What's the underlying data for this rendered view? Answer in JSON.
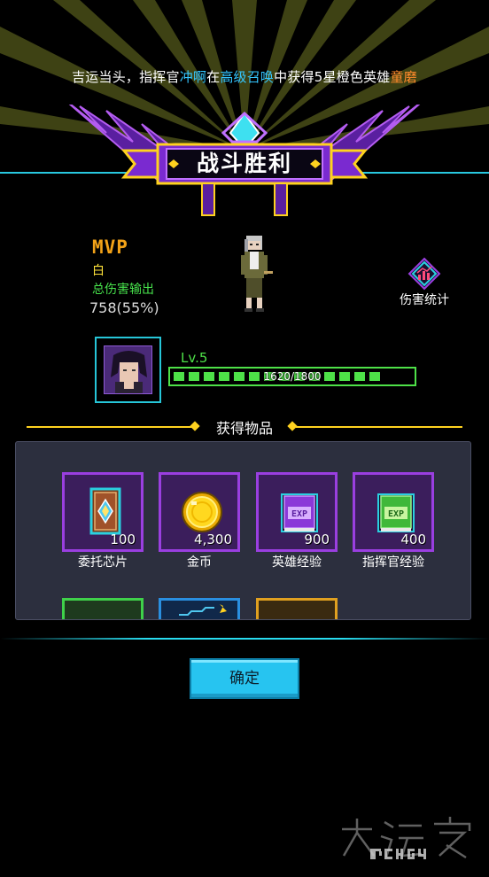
{
  "announcement": {
    "prefix": "吉运当头，指挥官",
    "player": "冲啊",
    "middle1": "在",
    "summon": "高级召唤",
    "middle2": "中获得5星橙色英雄",
    "hero": "童磨"
  },
  "banner": {
    "title": "战斗胜利"
  },
  "mvp": {
    "logo": "MVP",
    "hero_name": "白",
    "damage_label": "总伤害输出",
    "damage_value": "758(55%)"
  },
  "stats_button": {
    "label": "伤害统计"
  },
  "commander": {
    "level": "Lv.5",
    "exp_text": "1620/1800",
    "exp_fraction": 0.9
  },
  "rewards": {
    "title": "获得物品",
    "items": [
      {
        "label": "委托芯片",
        "qty": "100",
        "icon": "chip-card-icon"
      },
      {
        "label": "金币",
        "qty": "4,300",
        "icon": "gold-coin-icon"
      },
      {
        "label": "英雄经验",
        "qty": "900",
        "icon": "hero-exp-book-icon"
      },
      {
        "label": "指挥官经验",
        "qty": "400",
        "icon": "commander-exp-book-icon"
      }
    ],
    "partial_item_colors": [
      "#3fd14a",
      "#2a8fe0",
      "#e0a020"
    ]
  },
  "confirm_button": {
    "label": "确定"
  },
  "colors": {
    "accent_teal": "#28dcf0",
    "exp_green": "#4ee148",
    "item_border": "#9a3fe0",
    "banner_purple": "#7a2ad0",
    "gold": "#ffd21f"
  }
}
